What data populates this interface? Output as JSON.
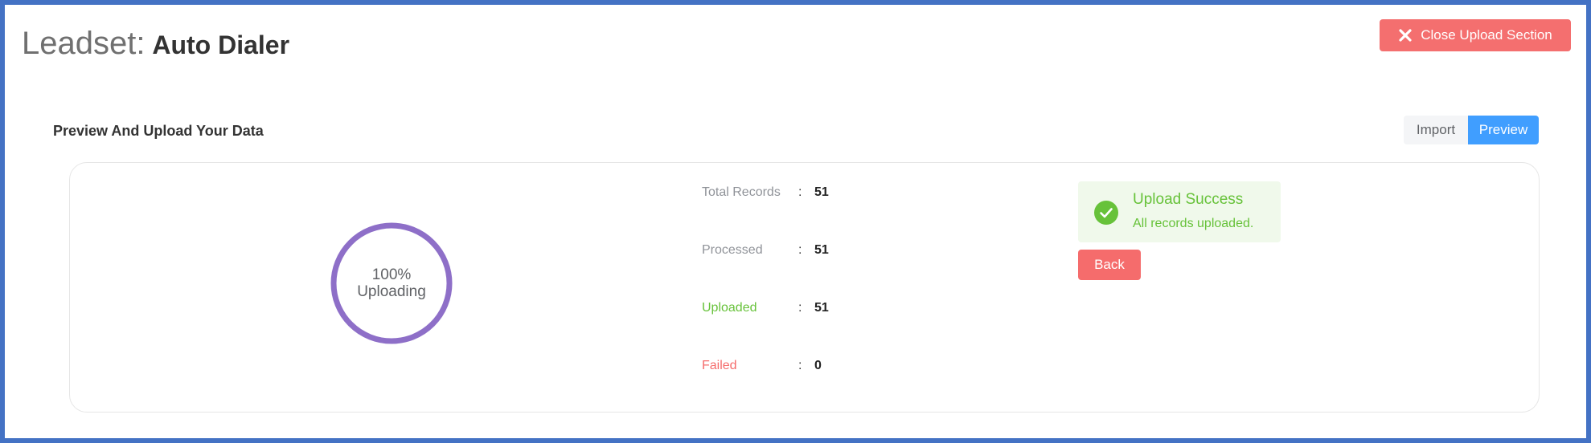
{
  "header": {
    "title_prefix": "Leadset:",
    "title_name": "Auto Dialer",
    "close_button_label": "Close Upload Section"
  },
  "section": {
    "title": "Preview And Upload Your Data",
    "tabs": [
      {
        "label": "Import",
        "active": false
      },
      {
        "label": "Preview",
        "active": true
      }
    ]
  },
  "progress": {
    "percent_text": "100%",
    "percent_value": 100,
    "status_text": "Uploading",
    "ring_color": "#8e6fc8"
  },
  "stats": [
    {
      "label": "Total Records",
      "separator": ":",
      "value": "51",
      "label_color": "gray"
    },
    {
      "label": "Processed",
      "separator": ":",
      "value": "51",
      "label_color": "gray"
    },
    {
      "label": "Uploaded",
      "separator": ":",
      "value": "51",
      "label_color": "green"
    },
    {
      "label": "Failed",
      "separator": ":",
      "value": "0",
      "label_color": "red"
    }
  ],
  "alert": {
    "icon": "check-circle-icon",
    "title": "Upload Success",
    "description": "All records uploaded."
  },
  "back_button_label": "Back",
  "colors": {
    "close_button": "#f46f6f",
    "preview_active": "#409eff",
    "success": "#67c23a",
    "danger": "#f56c6c",
    "frame_border": "#4472c4"
  }
}
